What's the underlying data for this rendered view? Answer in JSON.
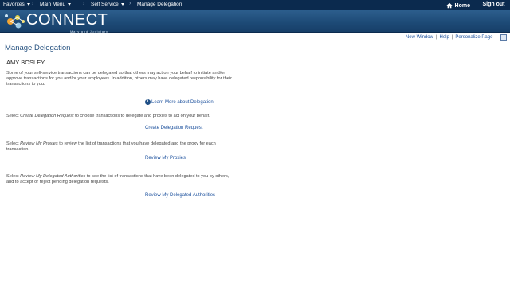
{
  "topnav": {
    "favorites": "Favorites",
    "main_menu": "Main Menu",
    "self_service": "Self Service",
    "current_page": "Manage Delegation",
    "home": "Home",
    "sign_out": "Sign out"
  },
  "banner": {
    "logo_text": "CONNECT",
    "logo_subtitle": "Maryland Judiciary"
  },
  "utility": {
    "new_window": "New Window",
    "help": "Help",
    "personalize": "Personalize Page"
  },
  "page": {
    "title": "Manage Delegation",
    "person_name": "AMY BOSLEY",
    "intro": "Some of your self-service transactions can be delegated so that others may act on your behalf to initiate and/or approve transactions for you and/or your employees. In addition, others may have delegated responsibility for their transactions to you.",
    "learn_more": "Learn More about Delegation",
    "create_text_pre": "Select ",
    "create_text_em": "Create Delegation Request",
    "create_text_post": " to choose transactions to delegate and proxies to act on your behalf.",
    "create_link": "Create Delegation Request",
    "proxies_text_pre": "Select ",
    "proxies_text_em": "Review My Proxies",
    "proxies_text_post": " to review the list of transactions that you have delegated and the proxy for each transaction.",
    "proxies_link": "Review My Proxies",
    "auth_text_pre": "Select ",
    "auth_text_em": "Review My Delegated Authorities",
    "auth_text_post": " to see the list of transactions that have been delegated to you by others, and to accept or reject pending delegation requests.",
    "auth_link": "Review My Delegated Authorities"
  },
  "colors": {
    "nav_bg": "#0b2a4e",
    "banner_bg": "#1d4a76",
    "link": "#1a4f9c",
    "title": "#24507f"
  }
}
